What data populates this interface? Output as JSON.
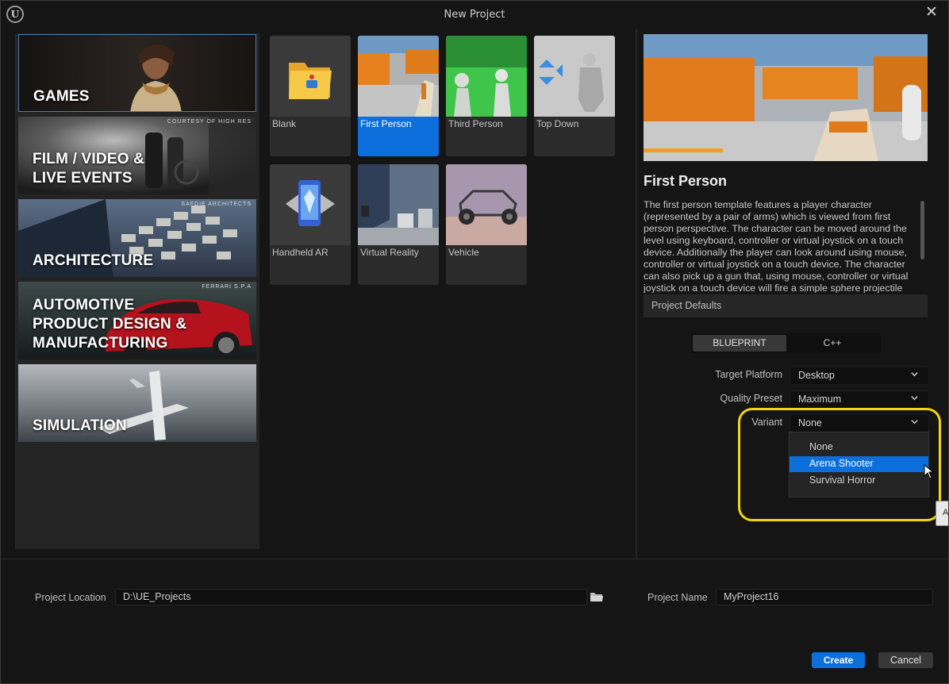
{
  "window": {
    "title": "New Project",
    "logo_text": "U"
  },
  "categories": [
    {
      "label": "GAMES",
      "credit": ""
    },
    {
      "label": "FILM / VIDEO &\nLIVE EVENTS",
      "credit": "COURTESY OF HIGH RES"
    },
    {
      "label": "ARCHITECTURE",
      "credit": "SAFDIE ARCHITECTS"
    },
    {
      "label": "AUTOMOTIVE\nPRODUCT DESIGN &\nMANUFACTURING",
      "credit": "FERRARI S.P.A"
    },
    {
      "label": "SIMULATION",
      "credit": ""
    }
  ],
  "templates": [
    {
      "label": "Blank"
    },
    {
      "label": "First Person"
    },
    {
      "label": "Third Person"
    },
    {
      "label": "Top Down"
    },
    {
      "label": "Handheld AR"
    },
    {
      "label": "Virtual Reality"
    },
    {
      "label": "Vehicle"
    }
  ],
  "details": {
    "title": "First Person",
    "description": "The first person template features a player character (represented by a pair of arms) which is viewed from first person perspective. The character can be moved around the level using keyboard, controller or virtual joystick on a touch device. Additionally the player can look around using mouse, controller or virtual joystick on a touch device. The character can also pick up a gun that, using mouse, controller or virtual joystick on a touch device will fire a simple sphere projectile",
    "defaults_header": "Project Defaults",
    "blueprint_label": "BLUEPRINT",
    "cpp_label": "C++",
    "target_platform": {
      "label": "Target Platform",
      "value": "Desktop"
    },
    "quality_preset": {
      "label": "Quality Preset",
      "value": "Maximum"
    },
    "variant": {
      "label": "Variant",
      "value": "None"
    },
    "variant_options": [
      "None",
      "Arena Shooter",
      "Survival Horror"
    ],
    "tooltip_fragment": "A"
  },
  "bottom": {
    "location_label": "Project Location",
    "location_value": "D:\\UE_Projects",
    "name_label": "Project Name",
    "name_value": "MyProject16",
    "create_label": "Create",
    "cancel_label": "Cancel"
  },
  "colors": {
    "accent": "#0d6fdc",
    "highlight": "#f0d512",
    "background": "#151515",
    "panel": "#242424"
  },
  "icons": [
    "ue-logo-icon",
    "close-icon",
    "folder-icon",
    "chevron-down-icon",
    "cursor-icon",
    "ar-phone-icon"
  ]
}
